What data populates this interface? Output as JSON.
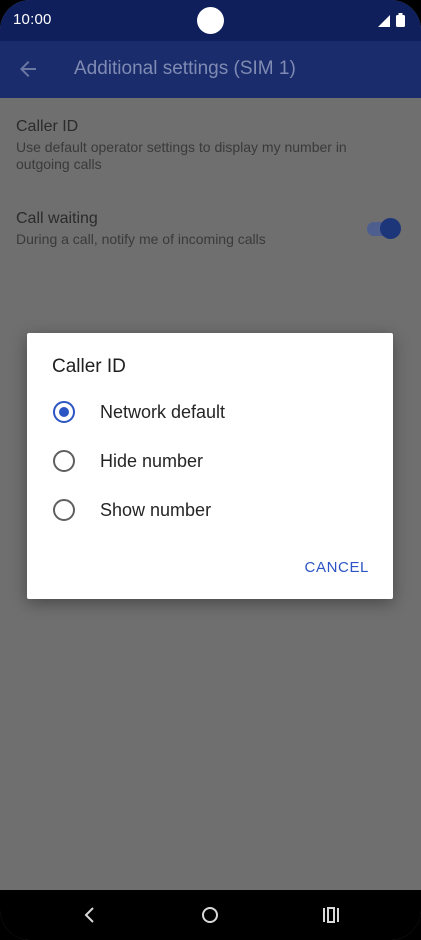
{
  "status_bar": {
    "time": "10:00",
    "icons": [
      "cell-signal-icon",
      "battery-icon"
    ]
  },
  "app_bar": {
    "back_icon": "arrow-left-icon",
    "title": "Additional settings (SIM 1)"
  },
  "settings": [
    {
      "title": "Caller ID",
      "summary": "Use default operator settings to display my number in outgoing calls"
    },
    {
      "title": "Call waiting",
      "summary": "During a call, notify me of incoming calls",
      "toggle_on": true
    }
  ],
  "dialog": {
    "title": "Caller ID",
    "options": [
      {
        "label": "Network default",
        "selected": true
      },
      {
        "label": "Hide number",
        "selected": false
      },
      {
        "label": "Show number",
        "selected": false
      }
    ],
    "cancel_label": "CANCEL"
  },
  "nav_bar": {
    "icons": [
      "back-icon",
      "home-icon",
      "recents-icon"
    ]
  },
  "colors": {
    "accent": "#2b55c4",
    "status_bar": "#0f1f5c",
    "scrim": "#6f6f6f"
  }
}
